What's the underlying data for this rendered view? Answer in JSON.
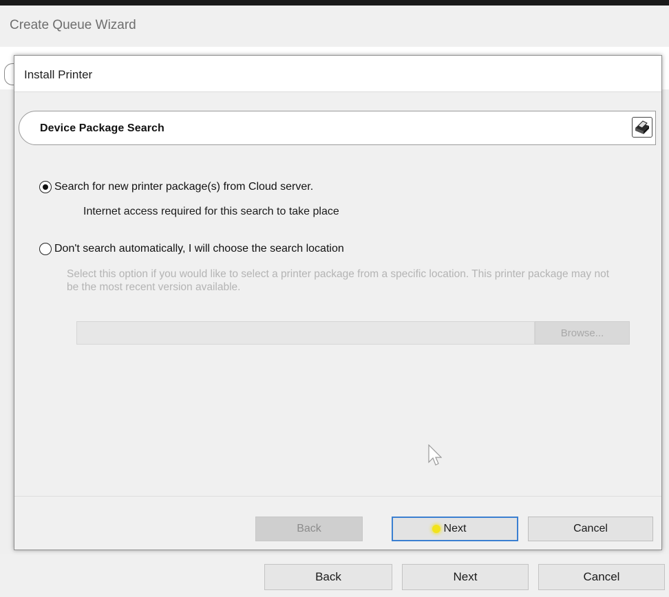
{
  "outer_window": {
    "title": "Create Queue Wizard",
    "buttons": {
      "back": "Back",
      "next": "Next",
      "cancel": "Cancel"
    }
  },
  "dialog": {
    "title": "Install Printer",
    "section_title": "Device Package Search",
    "section_icon": "printer-icon",
    "options": [
      {
        "label": "Search for new printer package(s) from Cloud server.",
        "sublabel": "Internet access required for this search to take place",
        "selected": true
      },
      {
        "label": "Don't search automatically, I will choose the search location",
        "description": "Select this option if you would like to select a printer package from a specific location. This printer package may not be the most recent version available.",
        "selected": false
      }
    ],
    "path_input": {
      "value": "",
      "disabled": true
    },
    "browse_label": "Browse...",
    "buttons": {
      "back": "Back",
      "next": "Next",
      "cancel": "Cancel"
    }
  },
  "colors": {
    "focus_border": "#3a7fd1",
    "disabled_text": "#b4b4b4",
    "click_highlight": "#f2e31a"
  }
}
